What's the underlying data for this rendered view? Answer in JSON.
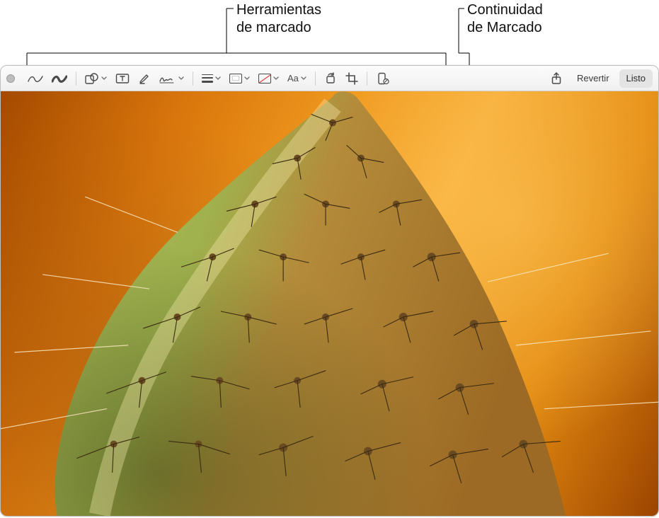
{
  "callouts": {
    "markup_tools": "Herramientas\nde marcado",
    "continuity": "Continuidad\nde Marcado"
  },
  "toolbar": {
    "tools": {
      "selection": "selection",
      "sketch": "sketch",
      "draw": "draw",
      "shapes": "shapes",
      "text": "text",
      "highlight": "highlight",
      "sign": "sign"
    },
    "style": {
      "stroke": "stroke-style",
      "border": "border-color",
      "border_color": "#ffffff",
      "fill": "fill-color",
      "font": "Aa"
    },
    "adjust": {
      "rotate": "rotate",
      "crop": "crop"
    },
    "continuity": "annotate-with-device",
    "share": "share",
    "revert": "Revertir",
    "done": "Listo"
  }
}
